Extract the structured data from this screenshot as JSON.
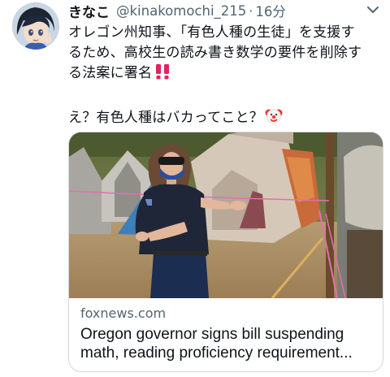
{
  "tweet": {
    "display_name": "きなこ",
    "handle": "@kinakomochi_215",
    "separator": "·",
    "time": "16分",
    "lines": [
      "オレゴン州知事、「有色人種の生徒」を支援す",
      "るため、高校生の読み書き数学の要件を削除す",
      "る法案に署名",
      "え？有色人種はバカってこと？"
    ],
    "emoji_line3": "double-exclamation-emoji",
    "emoji_line4": "clown-face-emoji"
  },
  "card": {
    "domain": "foxnews.com",
    "title_line1": "Oregon governor signs bill suspending",
    "title_line2": "math, reading proficiency requirement..."
  },
  "icons": {
    "more": "chevron-down-icon",
    "avatar": "avatar-illustration"
  },
  "colors": {
    "text_primary": "#0f1419",
    "text_secondary": "#536471",
    "card_border": "#cfd9de",
    "exclaim_red": "#e0245e"
  }
}
